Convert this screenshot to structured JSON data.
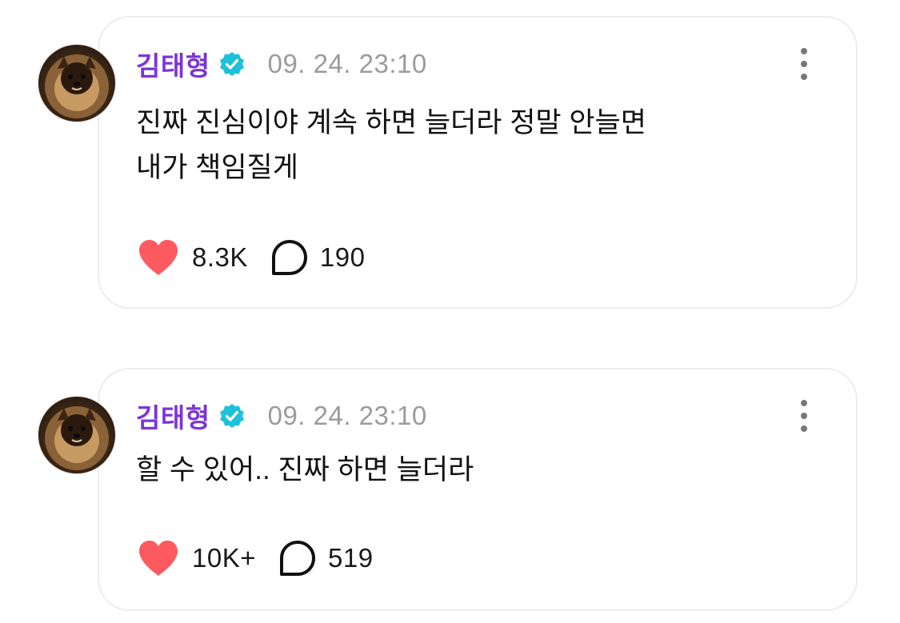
{
  "posts": [
    {
      "author": "김태형",
      "timestamp": "09. 24. 23:10",
      "text_lines": [
        "진짜 진심이야 계속 하면 늘더라 정말 안늘면",
        "내가 책임질게"
      ],
      "likes": "8.3K",
      "comments": "190"
    },
    {
      "author": "김태형",
      "timestamp": "09. 24. 23:10",
      "text_lines": [
        "할 수 있어.. 진짜 하면 늘더라"
      ],
      "likes": "10K+",
      "comments": "519"
    }
  ],
  "icons": {
    "verified": "verified-badge-icon",
    "heart": "heart-icon",
    "comment": "comment-bubble-icon",
    "more": "more-vertical-icon"
  },
  "colors": {
    "author": "#7b35d6",
    "verified": "#1fc1d8",
    "heart": "#ff5a5f",
    "timestamp": "#9a9aa0"
  }
}
